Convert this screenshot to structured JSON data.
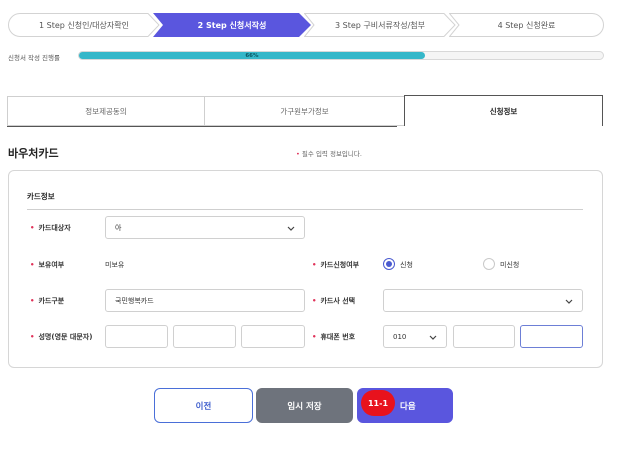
{
  "steps": [
    {
      "label": "1 Step 신청인/대상자확인"
    },
    {
      "label": "2 Step 신청서작성"
    },
    {
      "label": "3 Step 구비서류작성/첨부"
    },
    {
      "label": "4 Step 신청완료"
    }
  ],
  "progress": {
    "label": "신청서 작성 진행률",
    "percent_text": "66%",
    "value": 0.66
  },
  "tabs": [
    "정보제공동의",
    "가구원부가정보",
    "신청정보"
  ],
  "section": {
    "title": "바우처카드",
    "required_note": "필수 입력 정보입니다."
  },
  "panel": {
    "title": "카드정보",
    "card_target": {
      "label": "카드대상자",
      "value": "아"
    },
    "ownership": {
      "label": "보유여부",
      "value": "미보유"
    },
    "card_apply": {
      "label": "카드신청여부",
      "option_yes": "신청",
      "option_no": "미신청",
      "selected": "신청"
    },
    "card_type": {
      "label": "카드구분",
      "value": "국민행복카드"
    },
    "card_company": {
      "label": "카드사 선택",
      "value": ""
    },
    "name_en": {
      "label": "성명(영문 대문자)"
    },
    "phone": {
      "label": "휴대폰 번호",
      "prefix": "010"
    }
  },
  "buttons": {
    "prev": "이전",
    "save": "임시 저장",
    "next": "다음",
    "badge": "11-1"
  },
  "colors": {
    "accent": "#5a56de",
    "progress": "#35b7c9",
    "required": "#e0335a",
    "badge": "#e8121d"
  }
}
